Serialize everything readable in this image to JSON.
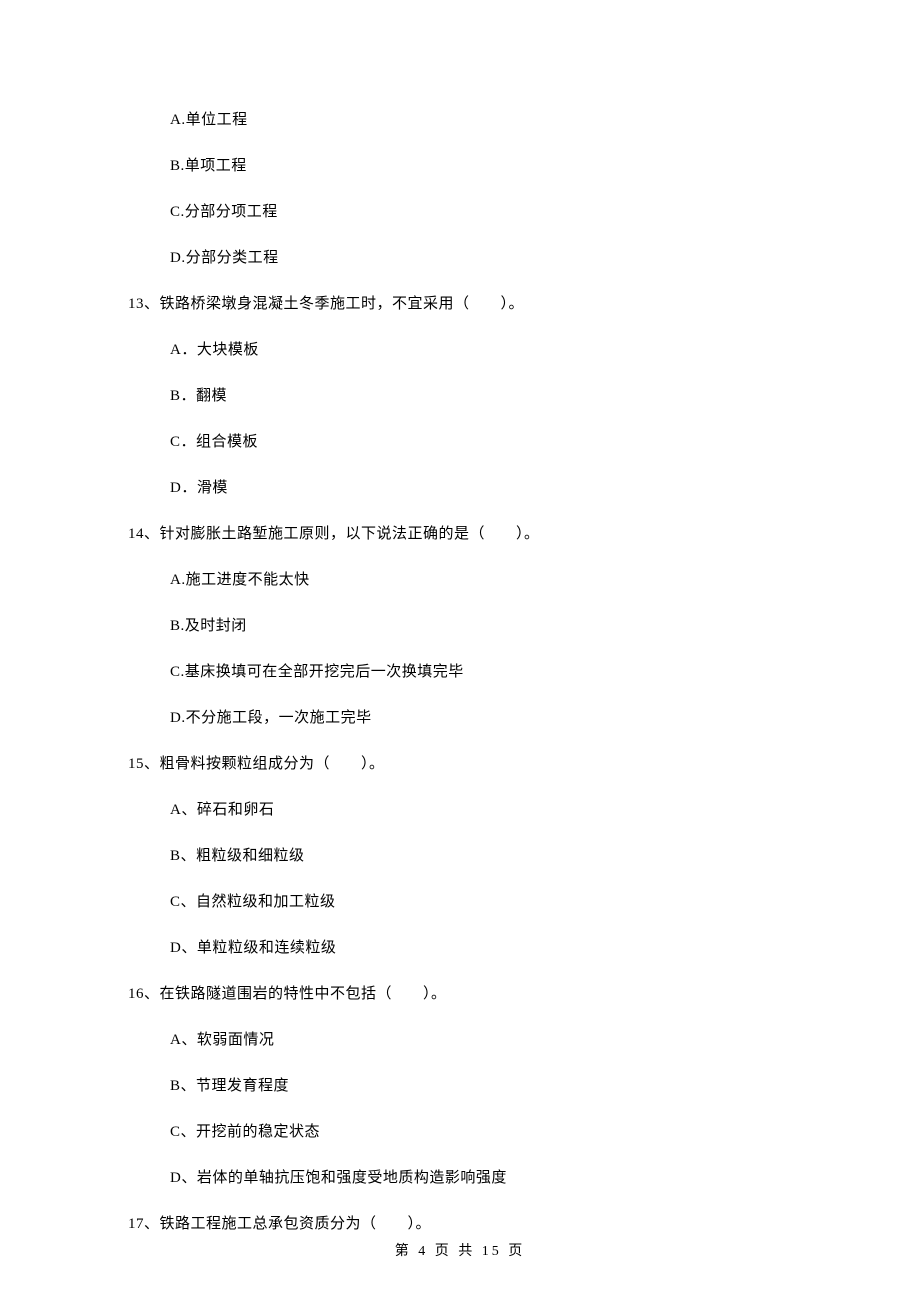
{
  "orphan_options": {
    "a": "A.单位工程",
    "b": "B.单项工程",
    "c": "C.分部分项工程",
    "d": "D.分部分类工程"
  },
  "q13": {
    "stem": "13、铁路桥梁墩身混凝土冬季施工时，不宜采用（　　）。",
    "a": "A．大块模板",
    "b": "B．翻模",
    "c": "C．组合模板",
    "d": "D．滑模"
  },
  "q14": {
    "stem": "14、针对膨胀土路堑施工原则，以下说法正确的是（　　）。",
    "a": "A.施工进度不能太快",
    "b": "B.及时封闭",
    "c": "C.基床换填可在全部开挖完后一次换填完毕",
    "d": "D.不分施工段，一次施工完毕"
  },
  "q15": {
    "stem": "15、粗骨料按颗粒组成分为（　　）。",
    "a": "A、碎石和卵石",
    "b": "B、粗粒级和细粒级",
    "c": "C、自然粒级和加工粒级",
    "d": "D、单粒粒级和连续粒级"
  },
  "q16": {
    "stem": "16、在铁路隧道围岩的特性中不包括（　　）。",
    "a": "A、软弱面情况",
    "b": "B、节理发育程度",
    "c": "C、开挖前的稳定状态",
    "d": "D、岩体的单轴抗压饱和强度受地质构造影响强度"
  },
  "q17": {
    "stem": "17、铁路工程施工总承包资质分为（　　）。"
  },
  "footer": "第 4 页 共 15 页"
}
